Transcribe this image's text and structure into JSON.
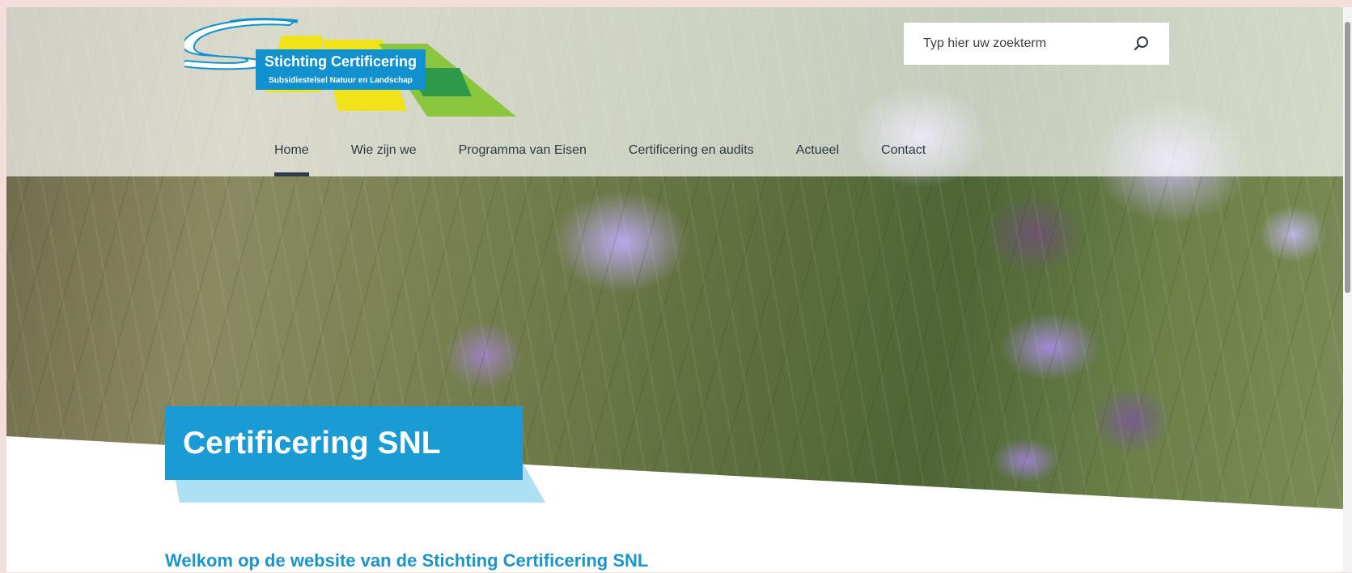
{
  "site": {
    "logo_name": "Stichting Certificering",
    "logo_subtitle": "Subsidiestelsel Natuur en Landschap"
  },
  "search": {
    "placeholder": "Typ hier uw zoekterm",
    "value": ""
  },
  "nav": {
    "items": [
      {
        "label": "Home",
        "active": true
      },
      {
        "label": "Wie zijn we"
      },
      {
        "label": "Programma van Eisen"
      },
      {
        "label": "Certificering en audits"
      },
      {
        "label": "Actueel"
      },
      {
        "label": "Contact"
      }
    ]
  },
  "hero": {
    "title": "Certificering SNL"
  },
  "main": {
    "welcome_heading": "Welkom op de website van de Stichting Certificering SNL"
  },
  "colors": {
    "brand_blue": "#1a9bd4",
    "brand_light_blue": "#ace0f2",
    "logo_yellow": "#f2e21a",
    "logo_green": "#8cc63f",
    "nav_text": "#2d3a44",
    "page_background": "#f3dedb"
  },
  "icons": {
    "search": "search-icon"
  }
}
